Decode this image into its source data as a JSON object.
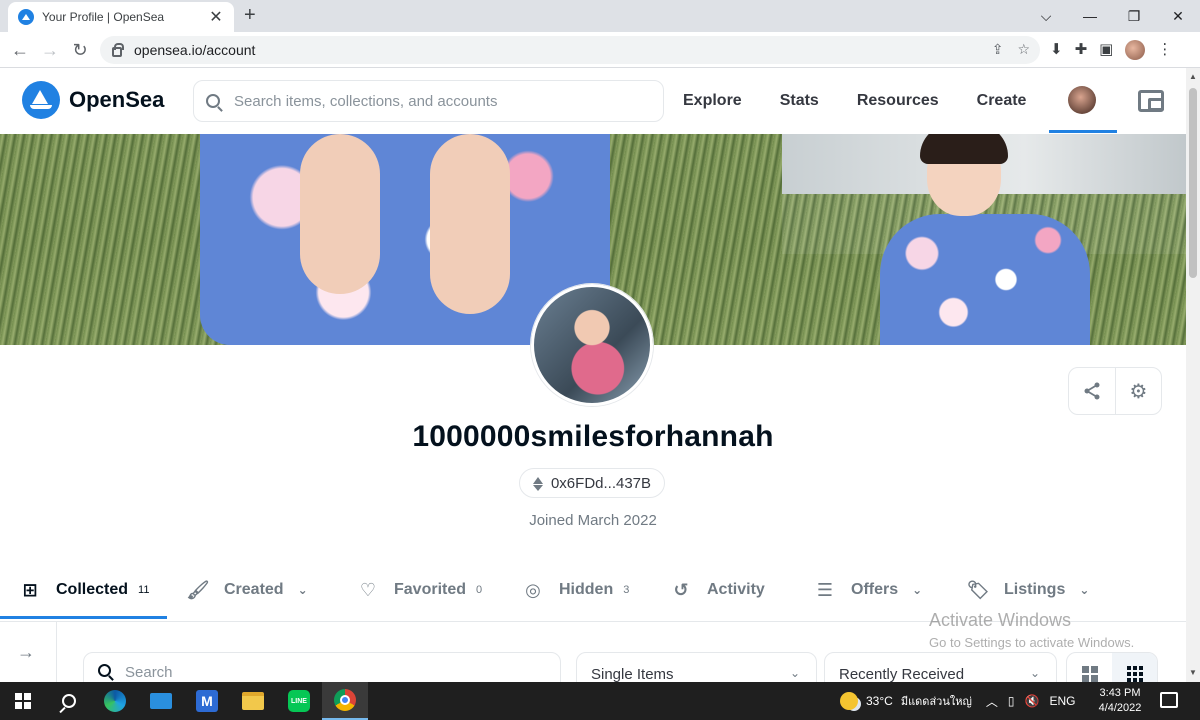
{
  "browser": {
    "tab_title": "Your Profile | OpenSea",
    "tab_close": "✕",
    "new_tab": "+",
    "url": "opensea.io/account",
    "window_controls": [
      "⌵",
      "—",
      "❐",
      "✕"
    ]
  },
  "header": {
    "logo_text": "OpenSea",
    "search_placeholder": "Search items, collections, and accounts",
    "nav": [
      "Explore",
      "Stats",
      "Resources",
      "Create"
    ]
  },
  "profile": {
    "username": "1000000smilesforhannah",
    "address": "0x6FDd...437B",
    "joined": "Joined March 2022"
  },
  "tabs": [
    {
      "label": "Collected",
      "count": "11",
      "icon": "collected-icon"
    },
    {
      "label": "Created",
      "icon": "brush-icon",
      "has_chevron": true
    },
    {
      "label": "Favorited",
      "count": "0",
      "icon": "heart-icon"
    },
    {
      "label": "Hidden",
      "count": "3",
      "icon": "eye-off-icon"
    },
    {
      "label": "Activity",
      "icon": "history-icon"
    },
    {
      "label": "Offers",
      "icon": "list-icon",
      "has_chevron": true
    },
    {
      "label": "Listings",
      "icon": "tag-icon",
      "has_chevron": true
    }
  ],
  "filters": {
    "search_placeholder": "Search",
    "type_select": "Single Items",
    "sort_select": "Recently Received"
  },
  "watermark": {
    "title": "Activate Windows",
    "subtitle": "Go to Settings to activate Windows."
  },
  "taskbar": {
    "weather": "33°C",
    "weather_desc": "มีแดดส่วนใหญ่",
    "language": "ENG",
    "time": "3:43 PM",
    "date": "4/4/2022"
  },
  "colors": {
    "accent": "#2081e2",
    "text_primary": "#04111d",
    "text_secondary": "#707a83",
    "border": "#e5e8eb"
  }
}
